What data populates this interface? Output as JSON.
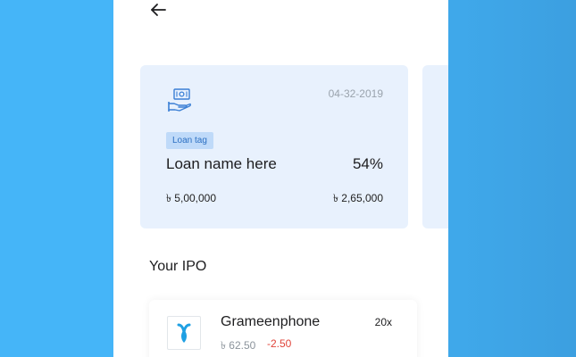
{
  "header": {
    "back_icon": "arrow-left-icon"
  },
  "loan_card": {
    "icon": "hand-holding-cash-icon",
    "date": "04-32-2019",
    "tag": "Loan tag",
    "name": "Loan name here",
    "percent": "54%",
    "amount_left": "৳ 5,00,000",
    "amount_right": "৳ 2,65,000"
  },
  "ipo": {
    "heading": "Your IPO",
    "items": [
      {
        "logo": "grameenphone-logo",
        "name": "Grameenphone",
        "multiplier": "20x",
        "price": "৳ 62.50",
        "change": "-2.50"
      }
    ]
  },
  "colors": {
    "background": "#45b5f8",
    "card": "#e8f1fd",
    "tag_bg": "#bfdaf9",
    "tag_text": "#2b6fc2",
    "negative": "#e0443a",
    "logo_blue": "#1fa0e3"
  }
}
